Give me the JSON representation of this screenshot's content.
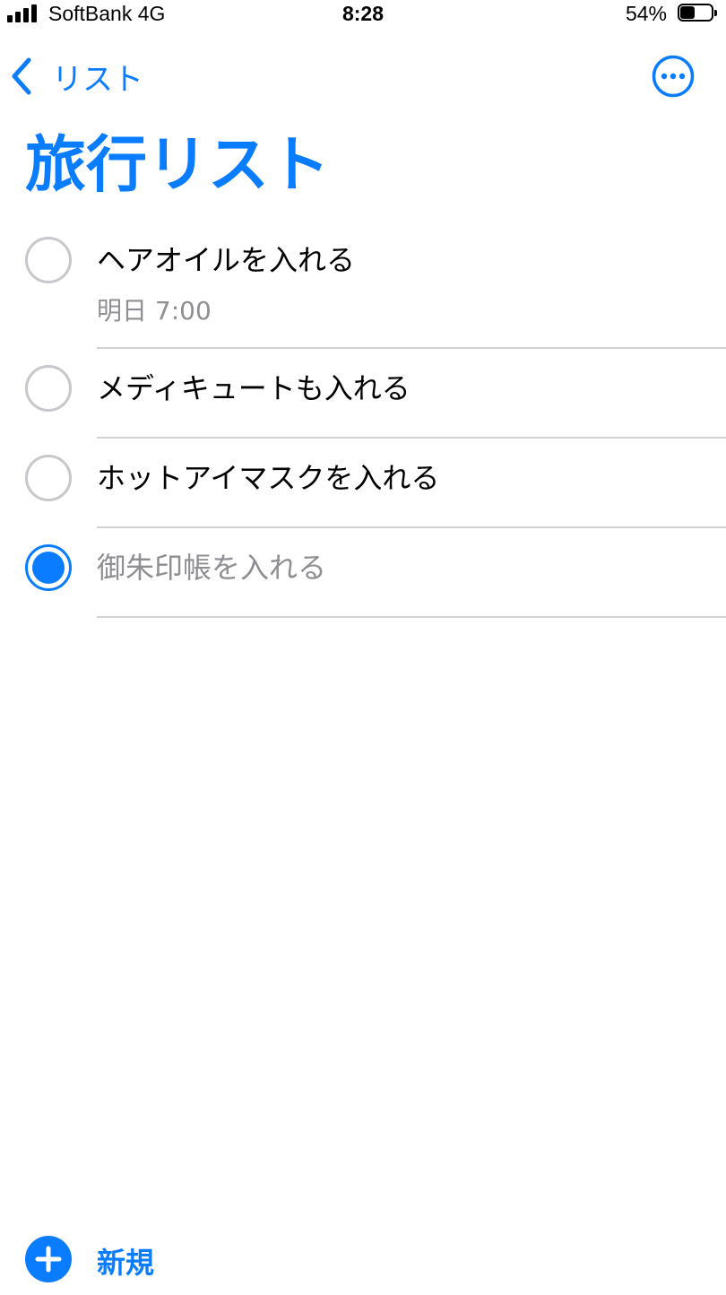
{
  "status_bar": {
    "carrier": "SoftBank   4G",
    "time": "8:28",
    "battery_percent_text": "54%",
    "battery_level": 0.54
  },
  "nav": {
    "back_label": "リスト",
    "back_icon": "chevron-left-icon",
    "more_icon": "ellipsis-circle-icon"
  },
  "list_title": "旅行リスト",
  "reminders": [
    {
      "title": "ヘアオイルを入れる",
      "due": "明日 7:00",
      "completed": false
    },
    {
      "title": "メディキュートも入れる",
      "completed": false
    },
    {
      "title": "ホットアイマスクを入れる",
      "completed": false
    },
    {
      "title": "御朱印帳を入れる",
      "completed": true
    }
  ],
  "footer": {
    "new_label": "新規",
    "new_icon": "plus-circle-icon"
  },
  "colors": {
    "accent": "#0a7cff",
    "secondary_text": "#8e8e93",
    "unchecked_circle": "#c7c7cc",
    "separator": "#d1d1d6"
  }
}
